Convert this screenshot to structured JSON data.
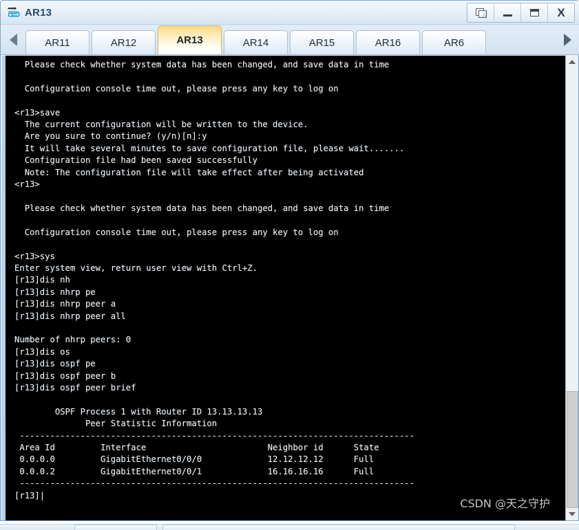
{
  "window": {
    "title": "AR13",
    "app_icon": "router-icon",
    "controls": [
      {
        "name": "restore-windows-button",
        "icon": "cascade-windows-icon",
        "label": ""
      },
      {
        "name": "minimize-button",
        "icon": "minimize-icon",
        "label": ""
      },
      {
        "name": "maximize-button",
        "icon": "maximize-icon",
        "label": ""
      },
      {
        "name": "close-button",
        "icon": "close-icon",
        "label": "X"
      }
    ]
  },
  "tabs": {
    "scroll_left_icon": "chevron-left-icon",
    "scroll_right_icon": "chevron-right-icon",
    "items": [
      {
        "label": "AR11",
        "active": false
      },
      {
        "label": "AR12",
        "active": false
      },
      {
        "label": "AR13",
        "active": true
      },
      {
        "label": "AR14",
        "active": false
      },
      {
        "label": "AR15",
        "active": false
      },
      {
        "label": "AR16",
        "active": false
      },
      {
        "label": "AR6",
        "active": false
      }
    ]
  },
  "terminal": {
    "background_color": "#000000",
    "text_color": "#f2f2f2",
    "prompt_user": "<r13>",
    "prompt_system": "[r13]",
    "content": "  Please check whether system data has been changed, and save data in time\n\n  Configuration console time out, please press any key to log on\n\n<r13>save\n  The current configuration will be written to the device.\n  Are you sure to continue? (y/n)[n]:y\n  It will take several minutes to save configuration file, please wait.......\n  Configuration file had been saved successfully\n  Note: The configuration file will take effect after being activated\n<r13>\n\n  Please check whether system data has been changed, and save data in time\n\n  Configuration console time out, please press any key to log on\n\n<r13>sys\nEnter system view, return user view with Ctrl+Z.\n[r13]dis nh\n[r13]dis nhrp pe\n[r13]dis nhrp peer a\n[r13]dis nhrp peer all\n\nNumber of nhrp peers: 0\n[r13]dis os\n[r13]dis ospf pe\n[r13]dis ospf peer b\n[r13]dis ospf peer brief\n\n        OSPF Process 1 with Router ID 13.13.13.13\n              Peer Statistic Information\n ------------------------------------------------------------------------------\n Area Id         Interface                        Neighbor id      State\n 0.0.0.0         GigabitEthernet0/0/0             12.12.12.12      Full\n 0.0.0.2         GigabitEthernet0/0/1             16.16.16.16      Full\n ------------------------------------------------------------------------------\n[r13]|",
    "ospf": {
      "process_line": "OSPF Process 1 with Router ID 13.13.13.13",
      "subtitle": "Peer Statistic Information",
      "process_id": "1",
      "router_id": "13.13.13.13",
      "columns": [
        "Area Id",
        "Interface",
        "Neighbor id",
        "State"
      ],
      "rows": [
        [
          "0.0.0.0",
          "GigabitEthernet0/0/0",
          "12.12.12.12",
          "Full"
        ],
        [
          "0.0.0.2",
          "GigabitEthernet0/0/1",
          "16.16.16.16",
          "Full"
        ]
      ]
    },
    "nhrp": {
      "peers_line": "Number of nhrp peers: 0",
      "peer_count": "0"
    },
    "commands": [
      "save",
      "sys",
      "dis nh",
      "dis nhrp pe",
      "dis nhrp peer a",
      "dis nhrp peer all",
      "dis os",
      "dis ospf pe",
      "dis ospf peer b",
      "dis ospf peer brief"
    ]
  },
  "scrollbar": {
    "up_arrow_icon": "caret-up-icon",
    "down_arrow_icon": "caret-down-icon"
  },
  "watermark": {
    "text": "CSDN @天之守护"
  }
}
